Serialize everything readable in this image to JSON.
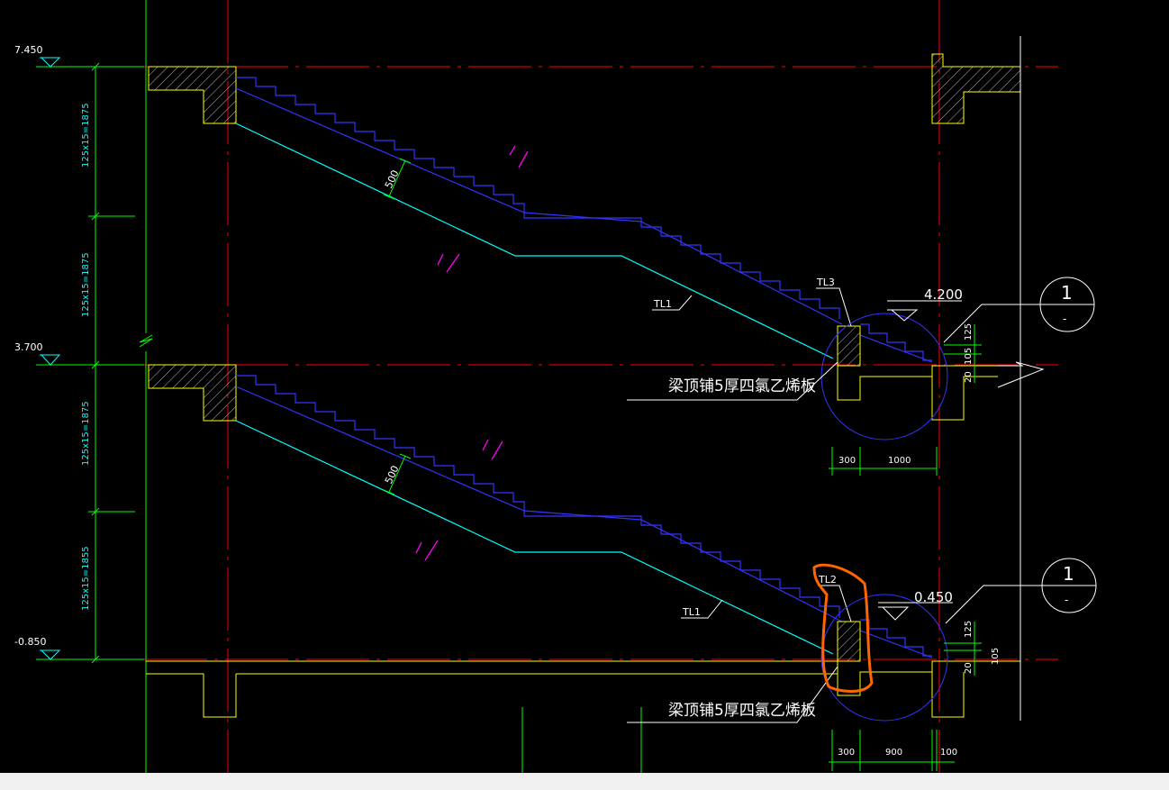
{
  "elevations": {
    "top": "7.450",
    "mid": "3.700",
    "bottom": "-0.850",
    "landing_upper": "4.200",
    "landing_lower": "0.450"
  },
  "vertical_dims": {
    "flight1": "125x15=1875",
    "flight2": "125x15=1875",
    "flight3": "125x15=1875",
    "flight4": "125x15=1855"
  },
  "slab_thickness": {
    "upper": "500",
    "lower": "500"
  },
  "beam_labels": {
    "tl1_upper": "TL1",
    "tl1_lower": "TL1",
    "tl3": "TL3",
    "tl2": "TL2"
  },
  "notes": {
    "upper": "梁顶铺5厚四氯乙烯板",
    "lower": "梁顶铺5厚四氯乙烯板"
  },
  "detail_dims": {
    "upper_125": "125",
    "upper_105": "105",
    "upper_20": "20",
    "lower_125": "125",
    "lower_105": "105",
    "lower_20": "20",
    "upper_300": "300",
    "upper_1000": "1000",
    "lower_300": "300",
    "lower_900": "900",
    "lower_100": "100"
  },
  "section_marks": {
    "upper_num": "1",
    "upper_den": "-",
    "lower_num": "1",
    "lower_den": "-"
  },
  "colors": {
    "background": "#000000",
    "axis": "#ff0000",
    "dim": "#00ff00",
    "stair": "#3333ff",
    "slab": "#00ffff",
    "wall": "#ffff00",
    "text": "#ffffff",
    "highlight": "#ff6600",
    "break_mark": "#ff00ff"
  }
}
